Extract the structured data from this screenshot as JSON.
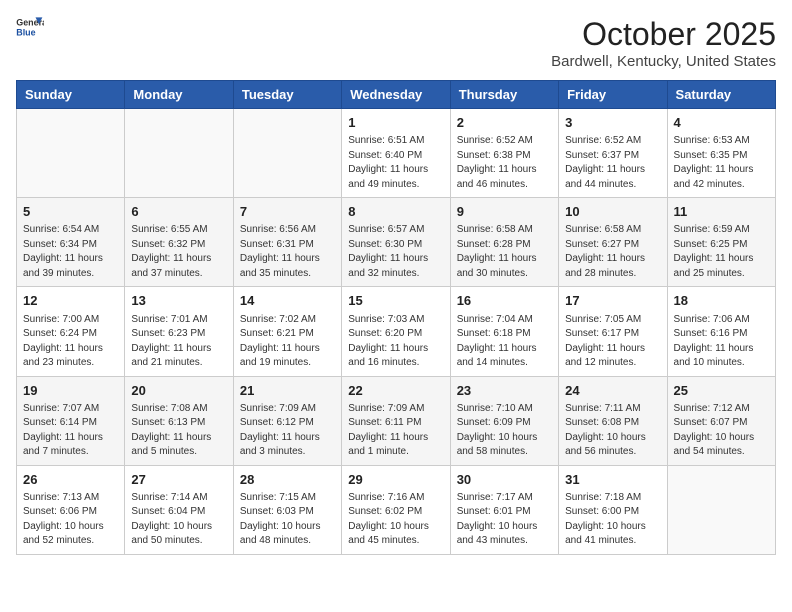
{
  "header": {
    "logo_general": "General",
    "logo_blue": "Blue",
    "month": "October 2025",
    "location": "Bardwell, Kentucky, United States"
  },
  "weekdays": [
    "Sunday",
    "Monday",
    "Tuesday",
    "Wednesday",
    "Thursday",
    "Friday",
    "Saturday"
  ],
  "weeks": [
    [
      {
        "day": "",
        "info": ""
      },
      {
        "day": "",
        "info": ""
      },
      {
        "day": "",
        "info": ""
      },
      {
        "day": "1",
        "info": "Sunrise: 6:51 AM\nSunset: 6:40 PM\nDaylight: 11 hours and 49 minutes."
      },
      {
        "day": "2",
        "info": "Sunrise: 6:52 AM\nSunset: 6:38 PM\nDaylight: 11 hours and 46 minutes."
      },
      {
        "day": "3",
        "info": "Sunrise: 6:52 AM\nSunset: 6:37 PM\nDaylight: 11 hours and 44 minutes."
      },
      {
        "day": "4",
        "info": "Sunrise: 6:53 AM\nSunset: 6:35 PM\nDaylight: 11 hours and 42 minutes."
      }
    ],
    [
      {
        "day": "5",
        "info": "Sunrise: 6:54 AM\nSunset: 6:34 PM\nDaylight: 11 hours and 39 minutes."
      },
      {
        "day": "6",
        "info": "Sunrise: 6:55 AM\nSunset: 6:32 PM\nDaylight: 11 hours and 37 minutes."
      },
      {
        "day": "7",
        "info": "Sunrise: 6:56 AM\nSunset: 6:31 PM\nDaylight: 11 hours and 35 minutes."
      },
      {
        "day": "8",
        "info": "Sunrise: 6:57 AM\nSunset: 6:30 PM\nDaylight: 11 hours and 32 minutes."
      },
      {
        "day": "9",
        "info": "Sunrise: 6:58 AM\nSunset: 6:28 PM\nDaylight: 11 hours and 30 minutes."
      },
      {
        "day": "10",
        "info": "Sunrise: 6:58 AM\nSunset: 6:27 PM\nDaylight: 11 hours and 28 minutes."
      },
      {
        "day": "11",
        "info": "Sunrise: 6:59 AM\nSunset: 6:25 PM\nDaylight: 11 hours and 25 minutes."
      }
    ],
    [
      {
        "day": "12",
        "info": "Sunrise: 7:00 AM\nSunset: 6:24 PM\nDaylight: 11 hours and 23 minutes."
      },
      {
        "day": "13",
        "info": "Sunrise: 7:01 AM\nSunset: 6:23 PM\nDaylight: 11 hours and 21 minutes."
      },
      {
        "day": "14",
        "info": "Sunrise: 7:02 AM\nSunset: 6:21 PM\nDaylight: 11 hours and 19 minutes."
      },
      {
        "day": "15",
        "info": "Sunrise: 7:03 AM\nSunset: 6:20 PM\nDaylight: 11 hours and 16 minutes."
      },
      {
        "day": "16",
        "info": "Sunrise: 7:04 AM\nSunset: 6:18 PM\nDaylight: 11 hours and 14 minutes."
      },
      {
        "day": "17",
        "info": "Sunrise: 7:05 AM\nSunset: 6:17 PM\nDaylight: 11 hours and 12 minutes."
      },
      {
        "day": "18",
        "info": "Sunrise: 7:06 AM\nSunset: 6:16 PM\nDaylight: 11 hours and 10 minutes."
      }
    ],
    [
      {
        "day": "19",
        "info": "Sunrise: 7:07 AM\nSunset: 6:14 PM\nDaylight: 11 hours and 7 minutes."
      },
      {
        "day": "20",
        "info": "Sunrise: 7:08 AM\nSunset: 6:13 PM\nDaylight: 11 hours and 5 minutes."
      },
      {
        "day": "21",
        "info": "Sunrise: 7:09 AM\nSunset: 6:12 PM\nDaylight: 11 hours and 3 minutes."
      },
      {
        "day": "22",
        "info": "Sunrise: 7:09 AM\nSunset: 6:11 PM\nDaylight: 11 hours and 1 minute."
      },
      {
        "day": "23",
        "info": "Sunrise: 7:10 AM\nSunset: 6:09 PM\nDaylight: 10 hours and 58 minutes."
      },
      {
        "day": "24",
        "info": "Sunrise: 7:11 AM\nSunset: 6:08 PM\nDaylight: 10 hours and 56 minutes."
      },
      {
        "day": "25",
        "info": "Sunrise: 7:12 AM\nSunset: 6:07 PM\nDaylight: 10 hours and 54 minutes."
      }
    ],
    [
      {
        "day": "26",
        "info": "Sunrise: 7:13 AM\nSunset: 6:06 PM\nDaylight: 10 hours and 52 minutes."
      },
      {
        "day": "27",
        "info": "Sunrise: 7:14 AM\nSunset: 6:04 PM\nDaylight: 10 hours and 50 minutes."
      },
      {
        "day": "28",
        "info": "Sunrise: 7:15 AM\nSunset: 6:03 PM\nDaylight: 10 hours and 48 minutes."
      },
      {
        "day": "29",
        "info": "Sunrise: 7:16 AM\nSunset: 6:02 PM\nDaylight: 10 hours and 45 minutes."
      },
      {
        "day": "30",
        "info": "Sunrise: 7:17 AM\nSunset: 6:01 PM\nDaylight: 10 hours and 43 minutes."
      },
      {
        "day": "31",
        "info": "Sunrise: 7:18 AM\nSunset: 6:00 PM\nDaylight: 10 hours and 41 minutes."
      },
      {
        "day": "",
        "info": ""
      }
    ]
  ]
}
